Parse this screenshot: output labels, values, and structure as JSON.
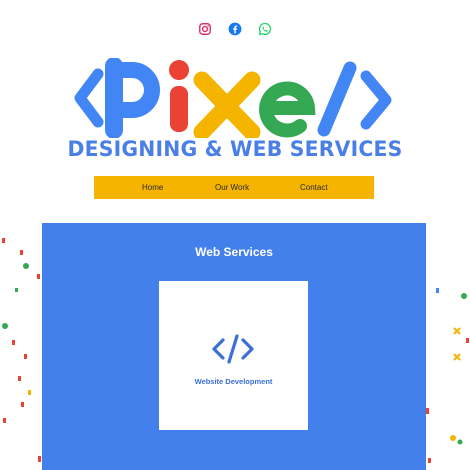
{
  "social": {
    "icons": [
      "instagram-icon",
      "facebook-icon",
      "whatsapp-icon"
    ],
    "colors": {
      "instagram": "#e1306c",
      "facebook": "#1877f2",
      "whatsapp": "#25d366"
    }
  },
  "logo": {
    "text": "<PiXel/>",
    "colors": {
      "blue": "#4285f4",
      "red": "#ea4335",
      "yellow": "#f4b400",
      "green": "#34a853"
    }
  },
  "tagline": "DESIGNING & WEB SERVICES",
  "nav": {
    "items": [
      "Home",
      "Our Work",
      "Contact"
    ],
    "background": "#f4b400"
  },
  "services": {
    "title": "Web Services",
    "background": "#4480ec",
    "cards": [
      {
        "label": "Website Development",
        "icon": "code-icon"
      }
    ]
  }
}
